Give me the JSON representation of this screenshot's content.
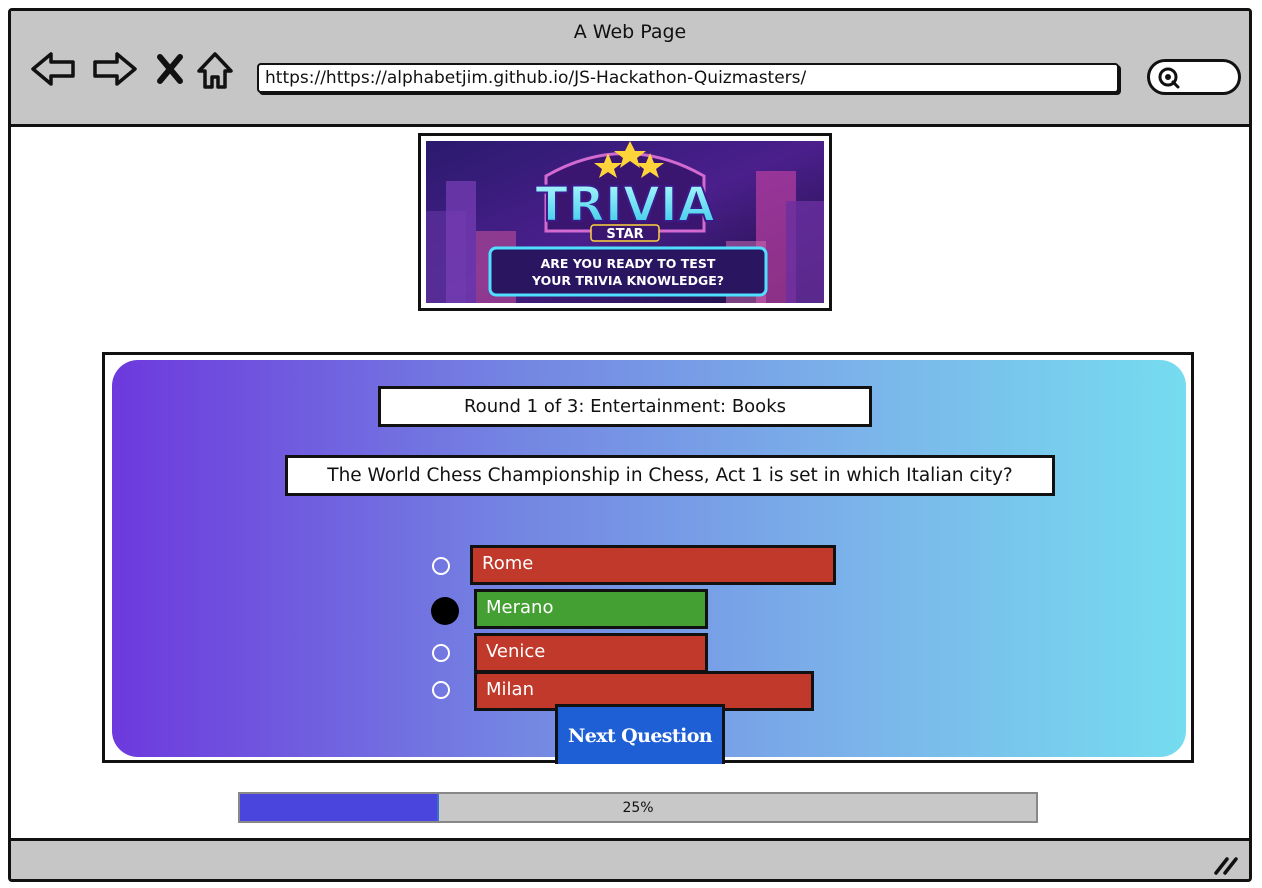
{
  "window": {
    "title": "A Web Page"
  },
  "nav": {
    "back_icon": "back-arrow-icon",
    "forward_icon": "forward-arrow-icon",
    "close_icon": "close-icon",
    "home_icon": "home-icon"
  },
  "address_bar": {
    "url": "https://https://alphabetjim.github.io/JS-Hackathon-Quizmasters/"
  },
  "search": {
    "icon": "search-icon"
  },
  "logo": {
    "title": "TRIVIA",
    "subtitle": "STAR",
    "tagline_line1": "ARE YOU READY TO TEST",
    "tagline_line2": "YOUR TRIVIA KNOWLEDGE?"
  },
  "quiz": {
    "round_label": "Round 1 of 3: Entertainment: Books",
    "question": "The World Chess Championship in Chess, Act 1 is set in which Italian city?",
    "answers": [
      {
        "label": "Rome",
        "selected": false,
        "status": "wrong"
      },
      {
        "label": "Merano",
        "selected": true,
        "status": "correct"
      },
      {
        "label": "Venice",
        "selected": false,
        "status": "wrong"
      },
      {
        "label": "Milan",
        "selected": false,
        "status": "wrong"
      }
    ],
    "next_button": "Next Question"
  },
  "progress": {
    "value": 0.25,
    "label": "25%"
  },
  "colors": {
    "correct": "#44a032",
    "wrong": "#c0392b",
    "next_button": "#1f5fd6",
    "progress_fill": "#4a45dc",
    "gradient_start": "#6d39dd",
    "gradient_end": "#75dcef"
  }
}
